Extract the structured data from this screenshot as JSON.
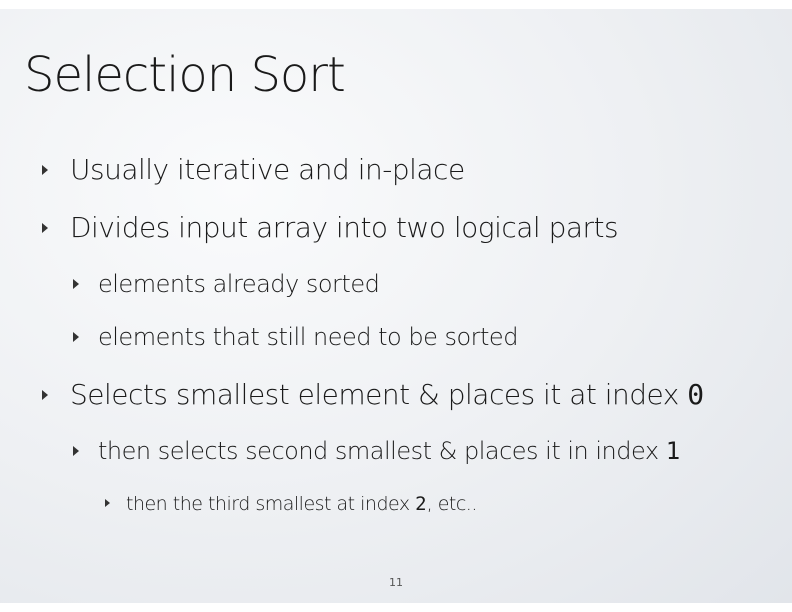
{
  "slide": {
    "title": "Selection Sort",
    "page_number": "11",
    "bullets": [
      {
        "text": "Usually iterative and in-place"
      },
      {
        "text": "Divides input array into two logical parts"
      },
      {
        "text": "elements already sorted"
      },
      {
        "text": "elements that still need to be sorted"
      },
      {
        "text": "Selects smallest element & places it at index ",
        "code": "0"
      },
      {
        "text": "then selects second smallest & places it in index ",
        "code": "1"
      },
      {
        "text": "then the third smallest at index ",
        "code": "2",
        "after": ", etc.."
      }
    ]
  }
}
